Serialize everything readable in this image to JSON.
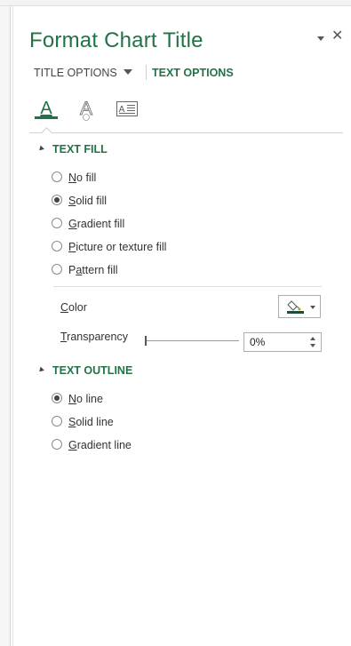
{
  "pane": {
    "title": "Format Chart Title",
    "close_symbol": "✕"
  },
  "options": {
    "title_options": "TITLE OPTIONS",
    "text_options": "TEXT OPTIONS"
  },
  "tab_icons": {
    "text_fill_outline_letter": "A",
    "text_effects_letter": "A",
    "textbox_letter": "A"
  },
  "text_fill": {
    "header": "TEXT FILL",
    "options": [
      {
        "accel": "N",
        "rest": "o fill",
        "selected": false
      },
      {
        "accel": "S",
        "rest": "olid fill",
        "selected": true
      },
      {
        "accel": "G",
        "rest": "radient fill",
        "selected": false
      },
      {
        "accel": "P",
        "rest": "icture or texture fill",
        "selected": false
      },
      {
        "pre": "P",
        "accel": "a",
        "rest": "ttern fill",
        "selected": false
      }
    ],
    "color_label_accel": "C",
    "color_label_rest": "olor",
    "transparency_label_accel": "T",
    "transparency_label_rest": "ransparency",
    "transparency_value": "0%",
    "transparency_level": 0,
    "fill_color": "#1e4e3a"
  },
  "text_outline": {
    "header": "TEXT OUTLINE",
    "options": [
      {
        "accel": "N",
        "rest": "o line",
        "selected": true
      },
      {
        "accel": "S",
        "rest": "olid line",
        "selected": false
      },
      {
        "accel": "G",
        "rest": "radient line",
        "selected": false
      }
    ]
  },
  "colors": {
    "accent": "#217346"
  }
}
